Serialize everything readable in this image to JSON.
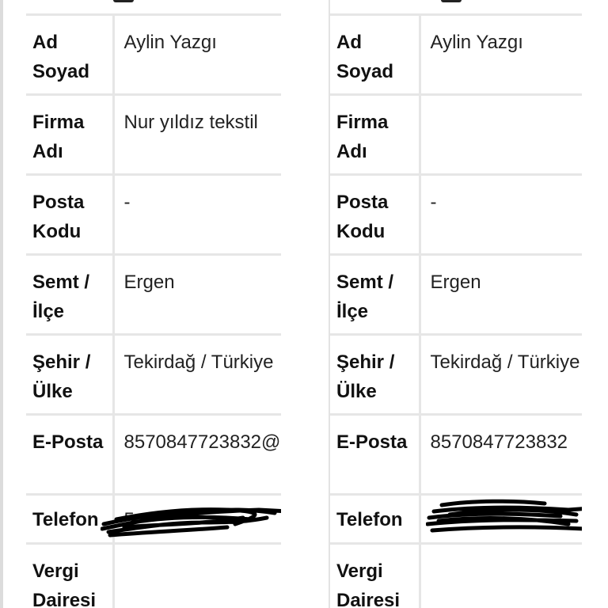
{
  "cards": [
    {
      "rows": [
        {
          "label": "Ad Soyad",
          "value": "Aylin Yazgı"
        },
        {
          "label": "Firma Adı",
          "value": "Nur yıldız tekstil"
        },
        {
          "label": "Posta Kodu",
          "value": "-"
        },
        {
          "label": "Semt / İlçe",
          "value": "Ergen"
        },
        {
          "label": "Şehir / Ülke",
          "value": "Tekirdağ / Türkiye"
        },
        {
          "label": "E-Posta",
          "value": "8570847723832@"
        },
        {
          "label": "Telefon",
          "value": "5"
        },
        {
          "label": "Vergi Dairesi",
          "value": ""
        }
      ]
    },
    {
      "rows": [
        {
          "label": "Ad Soyad",
          "value": "Aylin Yazgı"
        },
        {
          "label": "Firma Adı",
          "value": ""
        },
        {
          "label": "Posta Kodu",
          "value": "-"
        },
        {
          "label": "Semt / İlçe",
          "value": "Ergen"
        },
        {
          "label": "Şehir / Ülke",
          "value": "Tekirdağ / Türkiye"
        },
        {
          "label": "E-Posta",
          "value": "8570847723832"
        },
        {
          "label": "Telefon",
          "value": ""
        },
        {
          "label": "Vergi Dairesi",
          "value": ""
        }
      ]
    }
  ],
  "colors": {
    "border": "#e6e6e6",
    "label_text": "#111111",
    "value_text": "#222222",
    "redaction": "#000000"
  }
}
